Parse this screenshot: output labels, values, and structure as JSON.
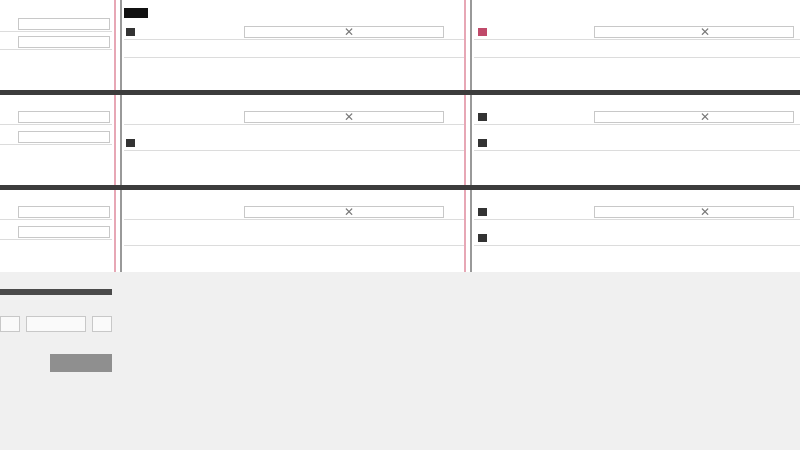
{
  "app": {
    "accent_dark": "#3c3c3c",
    "accent_pink": "#e7a7b5",
    "icons": [
      "close-icon",
      "color-square-icon",
      "tab-icon"
    ]
  },
  "bands": [
    {
      "rows_left": [
        {
          "value": ""
        },
        {
          "value": ""
        }
      ],
      "rows_mid": [
        {
          "label": ""
        },
        {
          "label": ""
        }
      ],
      "rows_right": [
        {
          "label": ""
        },
        {
          "label": ""
        }
      ],
      "total_left": "",
      "total_mid": "",
      "total_right": ""
    },
    {
      "rows_left": [
        {
          "value": ""
        },
        {
          "value": ""
        }
      ],
      "rows_mid": [
        {
          "label": ""
        },
        {
          "label": ""
        }
      ],
      "rows_right": [
        {
          "label": ""
        },
        {
          "label": ""
        }
      ],
      "total_left": "",
      "total_mid": "",
      "total_right": ""
    },
    {
      "rows_left": [
        {
          "value": ""
        },
        {
          "value": ""
        }
      ],
      "rows_mid": [
        {
          "label": ""
        },
        {
          "label": ""
        }
      ],
      "rows_right": [
        {
          "label": ""
        },
        {
          "label": ""
        }
      ],
      "total_left": "",
      "total_mid": "",
      "total_right": ""
    }
  ],
  "side_panel": {
    "label": "",
    "input_value": "",
    "button_label": "",
    "note": ""
  }
}
